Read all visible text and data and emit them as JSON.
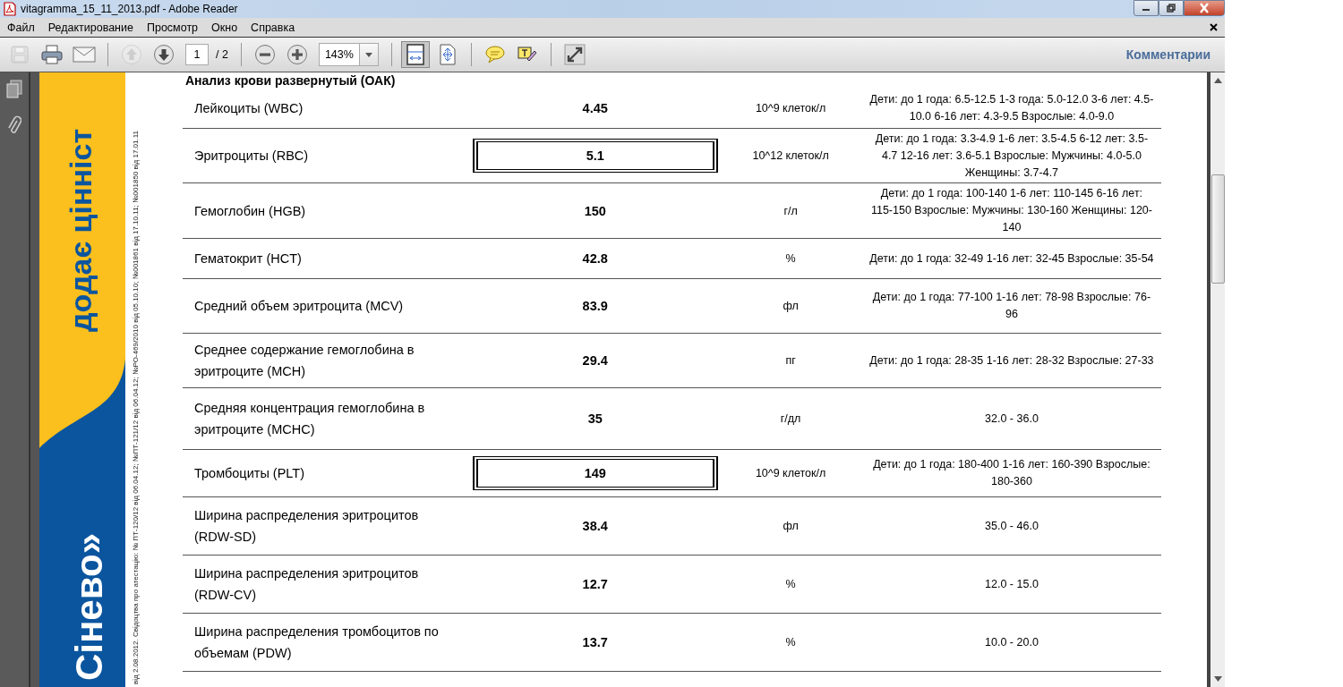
{
  "window": {
    "title": "vitagramma_15_11_2013.pdf - Adobe Reader"
  },
  "menu": [
    "Файл",
    "Редактирование",
    "Просмотр",
    "Окно",
    "Справка"
  ],
  "toolbar": {
    "buttons": [
      {
        "kind": "save",
        "disabled": true
      },
      {
        "kind": "print",
        "disabled": false
      },
      {
        "kind": "email",
        "disabled": false
      },
      {
        "kind": "sep"
      },
      {
        "kind": "prev",
        "disabled": true
      },
      {
        "kind": "next",
        "disabled": false
      },
      {
        "kind": "page"
      },
      {
        "kind": "sep"
      },
      {
        "kind": "zoomout",
        "disabled": false
      },
      {
        "kind": "zoomin",
        "disabled": false
      },
      {
        "kind": "zoom"
      },
      {
        "kind": "sep"
      },
      {
        "kind": "fitpage",
        "disabled": false,
        "selected": true
      },
      {
        "kind": "fitwidth",
        "disabled": false,
        "selected": false
      },
      {
        "kind": "sep"
      },
      {
        "kind": "comment",
        "disabled": false
      },
      {
        "kind": "highlight",
        "disabled": false
      },
      {
        "kind": "sep"
      },
      {
        "kind": "fullscreen",
        "disabled": false
      }
    ],
    "page_current": "1",
    "page_total": "/ 2",
    "zoom": "143%",
    "comments": "Комментарии"
  },
  "document": {
    "band_slogan": "додає цінніст",
    "band_brand": "Сінево»",
    "side_note": "від 2.08.2012. Свідоцтва про атестацію: № ПТ-120/12 від 06.04.12; №ПТ-121/12 від 06.04.12; №РО-469/2010 від 05.10.10; №001861 від 17.10.11; №001850 від 17.01.11",
    "section_title": "Анализ крови развернутый (ОАК)",
    "rows": [
      {
        "name": "Лейкоциты (WBC)",
        "value": "4.45",
        "unit": "10^9 клеток/л",
        "range": "Дети: до 1 года: 6.5-12.5 1-3 года: 5.0-12.0 3-6 лет: 4.5-10.0 6-16 лет: 4.3-9.5 Взрослые: 4.0-9.0",
        "flagged": false
      },
      {
        "name": "Эритроциты (RBC)",
        "value": "5.1",
        "unit": "10^12 клеток/л",
        "range": "Дети: до 1 года: 3.3-4.9 1-6 лет: 3.5-4.5 6-12 лет: 3.5-4.7 12-16 лет: 3.6-5.1 Взрослые: Мужчины: 4.0-5.0 Женщины: 3.7-4.7",
        "flagged": true
      },
      {
        "name": "Гемоглобин (HGB)",
        "value": "150",
        "unit": "г/л",
        "range": "Дети: до 1 года: 100-140 1-6 лет: 110-145 6-16 лет: 115-150 Взрослые: Мужчины: 130-160 Женщины: 120-140",
        "flagged": false
      },
      {
        "name": "Гематокрит (HCT)",
        "value": "42.8",
        "unit": "%",
        "range": "Дети: до 1 года: 32-49 1-16 лет: 32-45 Взрослые: 35-54",
        "flagged": false
      },
      {
        "name": "Средний объем эритроцита (MCV)",
        "value": "83.9",
        "unit": "фл",
        "range": "Дети: до 1 года: 77-100 1-16 лет: 78-98 Взрослые: 76-96",
        "flagged": false
      },
      {
        "name": "Среднее содержание гемоглобина в эритроците (MCH)",
        "value": "29.4",
        "unit": "пг",
        "range": "Дети: до 1 года: 28-35 1-16 лет: 28-32 Взрослые: 27-33",
        "flagged": false
      },
      {
        "name": "Средняя концентрация гемоглобина в эритроците (MCHC)",
        "value": "35",
        "unit": "г/дл",
        "range": "32.0 - 36.0",
        "flagged": false
      },
      {
        "name": "Тромбоциты (PLT)",
        "value": "149",
        "unit": "10^9 клеток/л",
        "range": "Дети: до 1 года: 180-400 1-16 лет: 160-390 Взрослые: 180-360",
        "flagged": true
      },
      {
        "name": "Ширина распределения эритроцитов (RDW-SD)",
        "value": "38.4",
        "unit": "фл",
        "range": "35.0 - 46.0",
        "flagged": false
      },
      {
        "name": "Ширина распределения эритроцитов (RDW-CV)",
        "value": "12.7",
        "unit": "%",
        "range": "12.0 - 15.0",
        "flagged": false
      },
      {
        "name": "Ширина распределения тромбоцитов по объемам (PDW)",
        "value": "13.7",
        "unit": "%",
        "range": "10.0 - 20.0",
        "flagged": false
      }
    ]
  }
}
